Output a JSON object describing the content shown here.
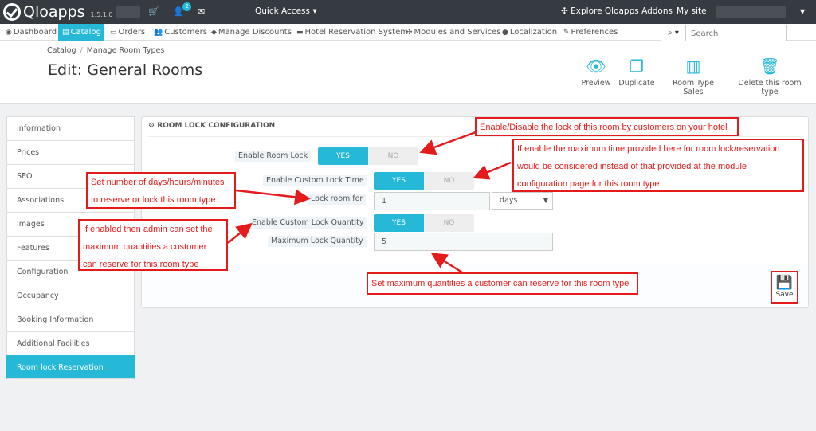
{
  "header": {
    "app_name": "Qloapps",
    "version": "1.5.1.0",
    "notification_count": "2",
    "quick_access": "Quick Access",
    "explore": "Explore Qloapps Addons",
    "my_site": "My site"
  },
  "nav": {
    "items": [
      {
        "label": "Dashboard",
        "icon": "dashboard-icon"
      },
      {
        "label": "Catalog",
        "icon": "book-icon"
      },
      {
        "label": "Orders",
        "icon": "credit-card-icon"
      },
      {
        "label": "Customers",
        "icon": "users-icon"
      },
      {
        "label": "Manage Discounts",
        "icon": "tag-icon"
      },
      {
        "label": "Hotel Reservation System",
        "icon": "bed-icon"
      },
      {
        "label": "Modules and Services",
        "icon": "puzzle-icon"
      },
      {
        "label": "Localization",
        "icon": "globe-icon"
      },
      {
        "label": "Preferences",
        "icon": "wrench-icon"
      }
    ],
    "search_placeholder": "Search"
  },
  "page": {
    "breadcrumb": [
      "Catalog",
      "Manage Room Types"
    ],
    "title": "Edit: General Rooms"
  },
  "toolbar": {
    "preview": "Preview",
    "duplicate": "Duplicate",
    "sales": "Room Type Sales",
    "delete": "Delete this room type"
  },
  "tabs": [
    "Information",
    "Prices",
    "SEO",
    "Associations",
    "Images",
    "Features",
    "Configuration",
    "Occupancy",
    "Booking Information",
    "Additional Facilities",
    "Room lock Reservation"
  ],
  "panel": {
    "heading": "ROOM LOCK CONFIGURATION",
    "enable_room_lock": "Enable Room Lock",
    "enable_custom_lock_time": "Enable Custom Lock Time",
    "lock_room_for": "Lock room for",
    "lock_room_value": "1",
    "lock_unit": "days",
    "enable_custom_lock_quantity": "Enable Custom Lock Quantity",
    "maximum_lock_quantity": "Maximum Lock Quantity",
    "max_qty_value": "5",
    "yes": "YES",
    "no": "NO",
    "save": "Save"
  },
  "annotations": {
    "a1": "Enable/Disable the lock of this room by customers on your hotel",
    "a2": "If enable the maximum time provided here for room lock/reservation would be considered instead of that provided at the module configuration page for this room type",
    "a3": "Set number of days/hours/minutes to reserve or lock this room type",
    "a4": "If enabled then admin can set the maximum quantities a customer can reserve for this room type",
    "a5": "Set maximum quantities a customer can reserve for this room type"
  },
  "colors": {
    "accent": "#25b9d7",
    "annotation": "#e51b1b",
    "header": "#363a41"
  }
}
